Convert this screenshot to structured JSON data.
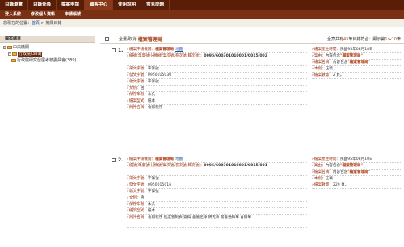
{
  "topnav": [
    "目錄瀏覽",
    "目錄查尋",
    "檔案申請",
    "顧客中心",
    "使用說明",
    "常見問題"
  ],
  "subnav": [
    "登入系統",
    "修改個人資料",
    "申請帳號"
  ],
  "breadcrumb": {
    "prefix": "您現在的位置：",
    "home": "首頁",
    "sep": " > ",
    "current": "機關目錄"
  },
  "sidebar": {
    "title": "檔案總目",
    "root": "中央機關",
    "dept": "行政院(389)",
    "child": "行政院研究發展考核委員會(389)"
  },
  "toolbar": {
    "label": "全選/取消",
    "title": "檔案管理局",
    "stats_prefix": "全案共有",
    "total": "45",
    "stats_mid": "筆目錄符合：顯示第",
    "range_from": "1",
    "range_to": "10",
    "stats_suffix": "筆"
  },
  "records": [
    {
      "num": "1.",
      "left": [
        {
          "label": "檔案申請機關：",
          "value": "檔案管理局",
          "link": "地圖"
        },
        {
          "label": "檔號(年度號/分類號/案次號/卷次號/目次號)：",
          "value": "0095/600301010001/0015/002"
        },
        {
          "label": "來文字號：",
          "value": "字第號"
        },
        {
          "label": "發文字號：",
          "value": "0950015030"
        },
        {
          "label": "收文字號：",
          "value": "字第號"
        },
        {
          "label": "文別：",
          "value": "函"
        },
        {
          "label": "保存年限：",
          "value": "永久"
        },
        {
          "label": "檔案型式：",
          "value": "紙本"
        },
        {
          "label": "附件名稱：",
          "value": "會辦程序"
        }
      ],
      "right": [
        {
          "label": "檔案產生時間：",
          "value": "民國95年08月18日"
        },
        {
          "label": "案由：",
          "value": "內容包含",
          "emph": "\"檔案管理局\""
        },
        {
          "label": "檔案名稱：",
          "value": "內容包含",
          "emph": "\"檔案管理局\""
        },
        {
          "label": "本別：",
          "value": "正稿"
        },
        {
          "label": "檔案數量：",
          "value": "2 頁。"
        }
      ]
    },
    {
      "num": "2.",
      "left": [
        {
          "label": "檔案申請機關：",
          "value": "檔案管理局",
          "link": "地圖"
        },
        {
          "label": "檔號(年度號/分類號/案次號/卷次號/目次號)：",
          "value": "0095/600301010001/0015/001"
        },
        {
          "label": "來文字號：",
          "value": "字第號"
        },
        {
          "label": "發文字號：",
          "value": "0950015016"
        },
        {
          "label": "收文字號：",
          "value": "字第號"
        },
        {
          "label": "文別：",
          "value": "函"
        },
        {
          "label": "保存年限：",
          "value": "永久"
        },
        {
          "label": "檔案型式：",
          "value": "紙本"
        },
        {
          "label": "附件名稱：",
          "value": "會辦程序 進度管制表 簽稿 會議記錄 研究表 開會通知單 會辦單"
        }
      ],
      "right": [
        {
          "label": "檔案產生時間：",
          "value": "民國95年08月10日"
        },
        {
          "label": "案由：",
          "value": "內容包含",
          "emph": "\"檔案管理局\""
        },
        {
          "label": "檔案名稱：",
          "value": "內容包含",
          "emph": "\"檔案管理局\""
        },
        {
          "label": "本別：",
          "value": "正稿"
        },
        {
          "label": "檔案數量：",
          "value": "229 頁。"
        }
      ]
    }
  ]
}
